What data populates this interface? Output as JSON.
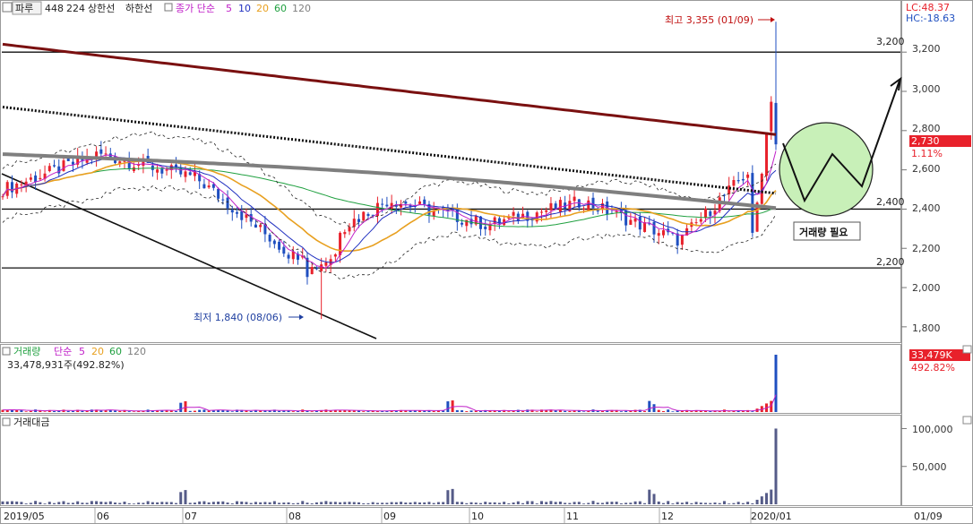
{
  "header": {
    "stock_tag": "파루",
    "stats": [
      "448",
      "224",
      "상한선",
      "하한선"
    ],
    "ma_prefix": "종가 단순",
    "ma_periods": [
      "5",
      "10",
      "20",
      "60",
      "120"
    ],
    "lc_label": "LC:48.37",
    "hc_label": "HC:-18.63"
  },
  "volume_header": {
    "title": "거래량",
    "ma_prefix": "단순",
    "ma_periods": [
      "5",
      "20",
      "60",
      "120"
    ],
    "value_text": "33,478,931주(492.82%)"
  },
  "amount_header": {
    "title": "거래대금"
  },
  "annotations": {
    "high_label": "최고 3,355 (01/09)",
    "low_label": "최저 1,840 (08/06)",
    "volume_needed": "거래량 필요"
  },
  "price_axis": {
    "ticks": [
      "3,200",
      "3,000",
      "2,800",
      "2,600",
      "2,400",
      "2,200",
      "2,000",
      "1,800"
    ],
    "current_price": "2,730",
    "current_change": "1.11%"
  },
  "volume_axis": {
    "current_label": "33,479K",
    "current_pct": "492.82%"
  },
  "amount_axis": {
    "ticks": [
      "100,000",
      "50,000"
    ]
  },
  "x_axis": {
    "labels": [
      "2019/05",
      "06",
      "07",
      "08",
      "09",
      "10",
      "11",
      "12",
      "2020/01"
    ],
    "right_label": "01/09"
  },
  "colors": {
    "up": "#e8212b",
    "down": "#1f4fc0",
    "ma5": "#c020c8",
    "ma10": "#2030c0",
    "ma20": "#e8a020",
    "ma60": "#20a040",
    "ma120": "#7f7f7f",
    "long_ma": "#7a1010",
    "dotted_ma": "#111111",
    "accent_box": "#e8212b"
  },
  "chart_data": {
    "type": "candlestick",
    "x": [
      "2019/05",
      "06",
      "07",
      "08",
      "09",
      "10",
      "11",
      "12",
      "2020/01"
    ],
    "price_ylim": [
      1740,
      3420
    ],
    "horizontal_levels": [
      3200,
      2400,
      2100
    ],
    "extremes": {
      "high": 3355,
      "high_date": "01/09",
      "low": 1840,
      "low_date": "08/06"
    },
    "price_series_monthly": [
      2500,
      2680,
      2560,
      2160,
      2450,
      2320,
      2440,
      2240,
      2730
    ],
    "volume_last": 33478931,
    "volume_pct": 492.82,
    "amount_ylim": [
      0,
      110000
    ]
  }
}
